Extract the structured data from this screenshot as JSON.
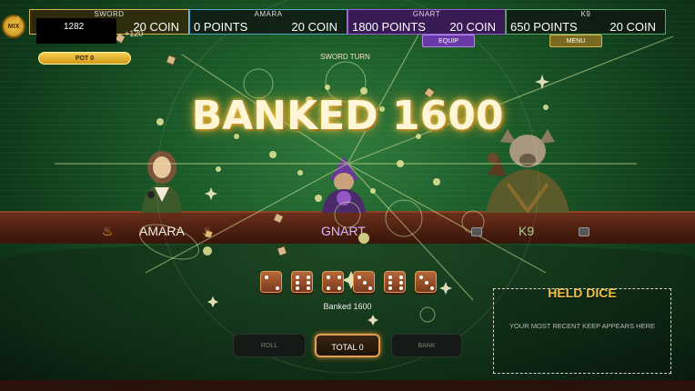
{
  "top_bar": {
    "music_button_label": "MIX",
    "players": [
      {
        "name": "SWORD",
        "points_text": "1282",
        "coin_text": "20 COIN",
        "bonus_text": "+120"
      },
      {
        "name": "AMARA",
        "points_text": "0 POINTS",
        "coin_text": "20 COIN"
      },
      {
        "name": "GNART",
        "points_text": "1800 POINTS",
        "coin_text": "20 COIN"
      },
      {
        "name": "K9",
        "points_text": "650 POINTS",
        "coin_text": "20 COIN"
      }
    ],
    "equip_label": "EQUIP",
    "menu_label": "MENU"
  },
  "pot_label": "POT 0",
  "turn_label": "SWORD TURN",
  "announcement": "BANKED 1600",
  "seats": {
    "amara": "AMARA",
    "gnart": "GNART",
    "k9": "K9"
  },
  "dice": {
    "values": [
      2,
      6,
      4,
      3,
      6,
      3
    ],
    "status_text": "Banked 1600"
  },
  "actions": {
    "roll_label": "ROLL",
    "total_label": "TOTAL 0",
    "bank_label": "BANK"
  },
  "held_dice": {
    "title": "HELD DICE",
    "hint": "YOUR MOST RECENT KEEP APPEARS HERE"
  },
  "colors": {
    "gold": "#f0c040",
    "felt": "#1b5a29",
    "rail": "#6a2e1a",
    "gnart_accent": "#9a5bd8"
  }
}
